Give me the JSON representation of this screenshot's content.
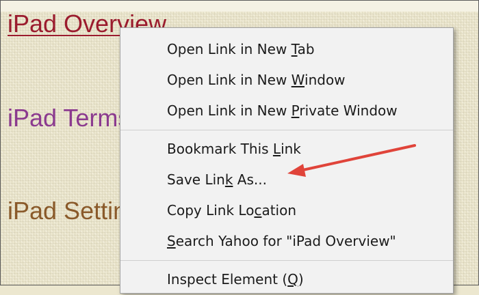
{
  "page": {
    "links": [
      {
        "label": "iPad Overview"
      },
      {
        "label": "iPad Terms"
      },
      {
        "label": "iPad Settings"
      }
    ]
  },
  "context_menu": {
    "items": [
      {
        "before": "Open Link in New ",
        "mnemonic": "T",
        "after": "ab"
      },
      {
        "before": "Open Link in New ",
        "mnemonic": "W",
        "after": "indow"
      },
      {
        "before": "Open Link in New ",
        "mnemonic": "P",
        "after": "rivate Window"
      },
      {
        "before": "Bookmark This ",
        "mnemonic": "L",
        "after": "ink"
      },
      {
        "before": "Save Lin",
        "mnemonic": "k",
        "after": " As..."
      },
      {
        "before": "Copy Link Lo",
        "mnemonic": "c",
        "after": "ation"
      },
      {
        "before": "",
        "mnemonic": "S",
        "after": "earch Yahoo for \"iPad Overview\""
      },
      {
        "before": "Inspect Element (",
        "mnemonic": "Q",
        "after": ")"
      }
    ]
  },
  "colors": {
    "annotation_arrow": "#e0443a",
    "visited_link": "#9b1c2e",
    "link_purple": "#8b3a8f",
    "link_brown": "#8a5a2a"
  },
  "annotation": {
    "type": "arrow",
    "icon": "red-arrow-icon"
  }
}
